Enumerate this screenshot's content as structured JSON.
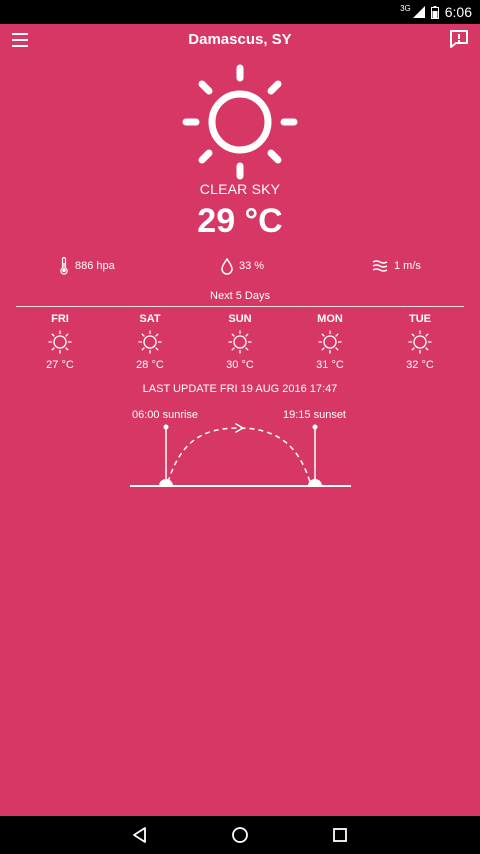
{
  "status_bar": {
    "network": "3G",
    "time": "6:06"
  },
  "app_bar": {
    "title": "Damascus, SY",
    "menu_icon": "menu-icon",
    "report_icon": "report-icon"
  },
  "current": {
    "icon": "sun-icon",
    "condition": "CLEAR SKY",
    "temperature": "29 °C",
    "pressure": "886 hpa",
    "humidity": "33 %",
    "wind": "1 m/s"
  },
  "forecast": {
    "label": "Next 5 Days",
    "days": [
      {
        "name": "FRI",
        "temp": "27 °C",
        "icon": "sun-icon"
      },
      {
        "name": "SAT",
        "temp": "28 °C",
        "icon": "sun-icon"
      },
      {
        "name": "SUN",
        "temp": "30 °C",
        "icon": "sun-icon"
      },
      {
        "name": "MON",
        "temp": "31 °C",
        "icon": "sun-icon"
      },
      {
        "name": "TUE",
        "temp": "32 °C",
        "icon": "sun-icon"
      }
    ]
  },
  "last_update": "LAST UPDATE FRI 19 AUG 2016 17:47",
  "sun": {
    "sunrise": "06:00 sunrise",
    "sunset": "19:15 sunset"
  },
  "colors": {
    "background": "#d73765",
    "foreground": "#ffffff",
    "bars": "#000000"
  }
}
